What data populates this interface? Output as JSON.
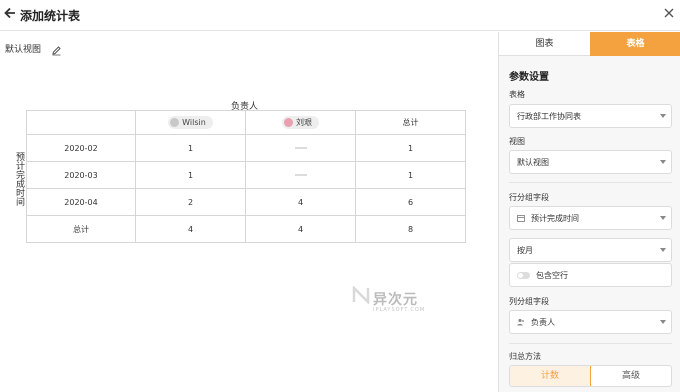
{
  "header": {
    "title": "添加统计表"
  },
  "left": {
    "view_name": "默认视图",
    "column_field_title": "负责人",
    "row_field_title": "预计完成时间",
    "table": {
      "column_headers": [
        "Wilsin",
        "刘艰",
        "总计"
      ],
      "rows": [
        {
          "label": "2020-02",
          "cells": [
            "1",
            "",
            "1"
          ]
        },
        {
          "label": "2020-03",
          "cells": [
            "1",
            "",
            "1"
          ]
        },
        {
          "label": "2020-04",
          "cells": [
            "2",
            "4",
            "6"
          ]
        },
        {
          "label": "总计",
          "cells": [
            "4",
            "4",
            "8"
          ]
        }
      ]
    },
    "watermark": {
      "title": "异次元",
      "subtitle": "IPLAYSOFT.COM"
    }
  },
  "panel": {
    "tabs": [
      "图表",
      "表格"
    ],
    "active_tab": "表格",
    "section_title": "参数设置",
    "table_label": "表格",
    "table_value": "行政部工作协同表",
    "view_label": "视图",
    "view_value": "默认视图",
    "row_group_label": "行分组字段",
    "row_group_value": "预计完成时间",
    "row_group_mode": "按月",
    "include_empty_label": "包含空行",
    "col_group_label": "列分组字段",
    "col_group_value": "负责人",
    "summary_label": "归总方法",
    "summary_options": [
      "计数",
      "高级"
    ]
  },
  "colors": {
    "accent": "#f4a23f"
  }
}
